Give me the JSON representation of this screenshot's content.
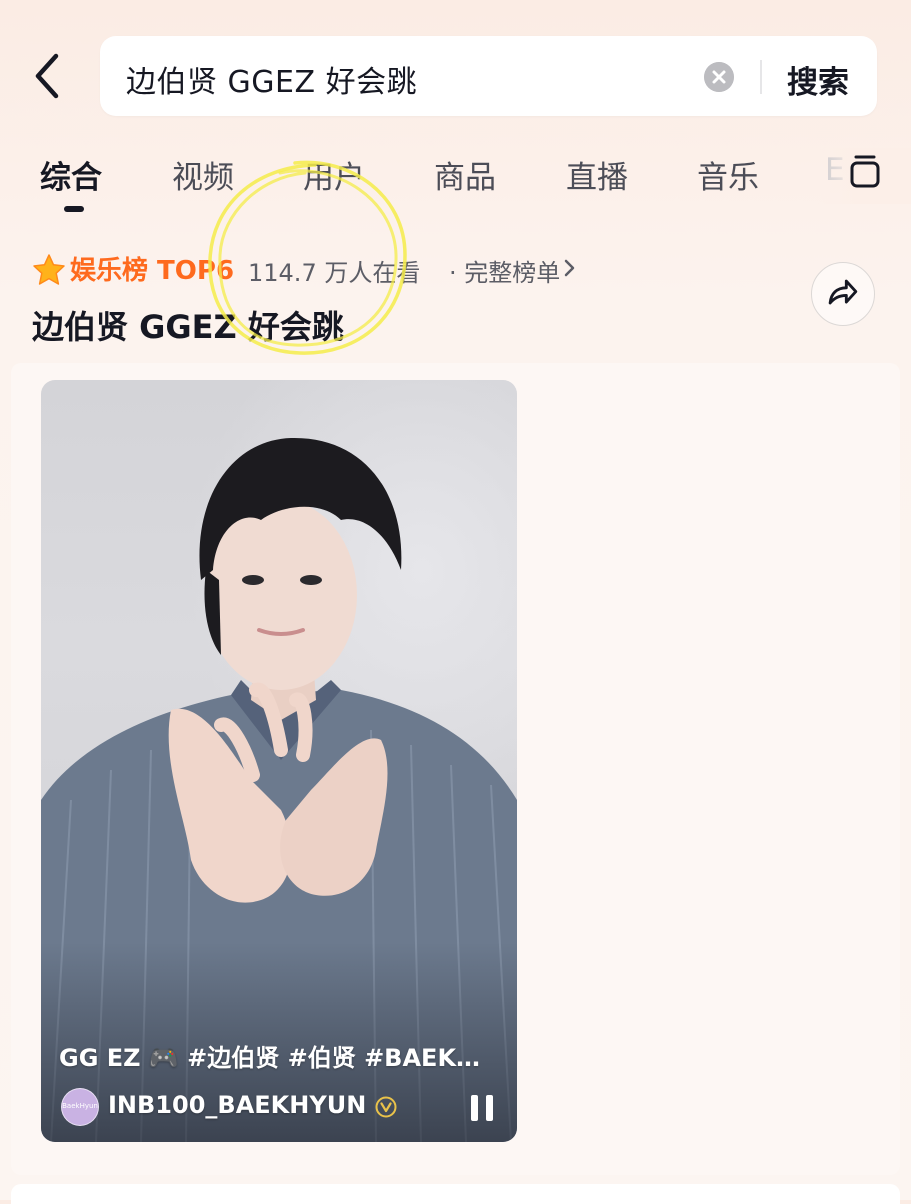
{
  "header": {
    "search_query": "边伯贤 GGEZ 好会跳",
    "search_button": "搜索"
  },
  "tabs": [
    {
      "label": "综合",
      "active": true
    },
    {
      "label": "视频"
    },
    {
      "label": "用户"
    },
    {
      "label": "商品"
    },
    {
      "label": "直播"
    },
    {
      "label": "音乐"
    },
    {
      "label": "E"
    }
  ],
  "ranking": {
    "label": "娱乐榜 TOP6",
    "viewers": "114.7 万人在看",
    "full_list": "· 完整榜单",
    "title": "边伯贤 GGEZ 好会跳"
  },
  "video": {
    "caption": "GG EZ 🎮 #边伯贤 #伯贤 #BAEK…",
    "author": "INB100_BAEKHYUN",
    "avatar_text": "BaekHyun"
  },
  "colors": {
    "accent_orange": "#fe6a1e",
    "star_yellow": "#ffb21a",
    "annotation_yellow": "#f4ec4a",
    "verified_gold": "#e9c24a"
  },
  "icons": [
    "back-arrow-icon",
    "clear-icon",
    "layout-toggle-icon",
    "star-icon",
    "chevron-right-icon",
    "share-icon",
    "verified-icon",
    "pause-icon"
  ]
}
